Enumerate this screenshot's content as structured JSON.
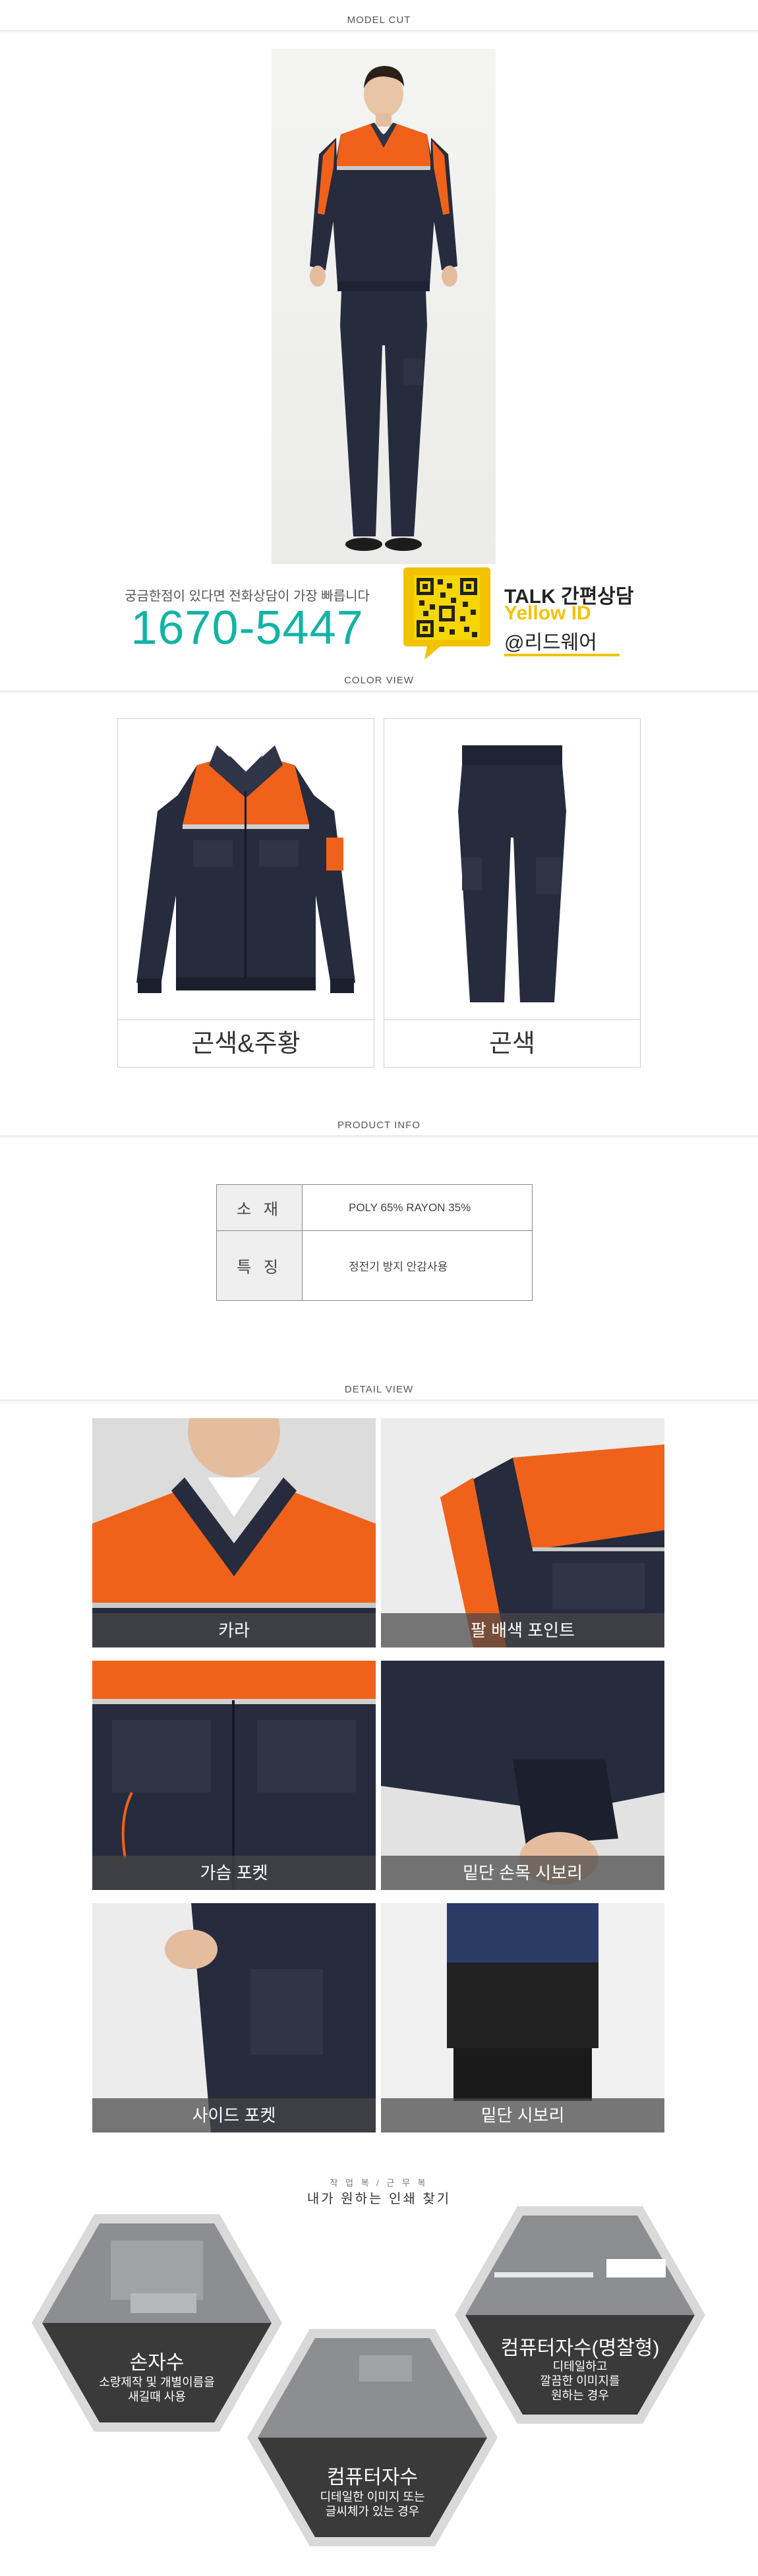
{
  "sections": {
    "model_cut": "MODEL CUT",
    "color_view": "COLOR VIEW",
    "product_info": "PRODUCT INFO",
    "detail_view": "DETAIL VIEW"
  },
  "contact": {
    "subtitle": "궁금한점이 있다면 전화상담이 가장 빠릅니다",
    "phone": "1670-5447",
    "talk_line1": "TALK 간편상담",
    "talk_line2": "Yellow ID",
    "talk_line3": "@리드웨어"
  },
  "colors": [
    {
      "label": "곤색&주황"
    },
    {
      "label": "곤색"
    }
  ],
  "product_info": {
    "rows": [
      {
        "key": "소 재",
        "value": "POLY 65% RAYON 35%"
      },
      {
        "key": "특 징",
        "value": "정전기 방지 안감사용"
      }
    ]
  },
  "details": [
    {
      "label": "카라"
    },
    {
      "label": "팔 배색 포인트"
    },
    {
      "label": "가슴 포켓"
    },
    {
      "label": "밑단 손목 시보리"
    },
    {
      "label": "사이드 포켓"
    },
    {
      "label": "밑단 시보리"
    }
  ],
  "embroidery": {
    "subtitle": "작 업 복 / 근 무 복",
    "title": "내가 원하는 인쇄 찾기",
    "options": [
      {
        "title": "손자수",
        "desc_line1": "소량제작 및 개별이름을",
        "desc_line2": "새길때 사용"
      },
      {
        "title": "컴퓨터자수",
        "desc_line1": "디테일한 이미지 또는",
        "desc_line2": "글씨체가 있는 경우"
      },
      {
        "title": "컴퓨터자수(명찰형)",
        "desc_line1": "디테일하고",
        "desc_line2": "깔끔한 이미지를",
        "desc_line3": "원하는 경우"
      }
    ]
  },
  "palette": {
    "navy": "#23283a",
    "orange": "#f0621a",
    "teal": "#13b3a4",
    "kakao_yellow": "#f2c200"
  }
}
